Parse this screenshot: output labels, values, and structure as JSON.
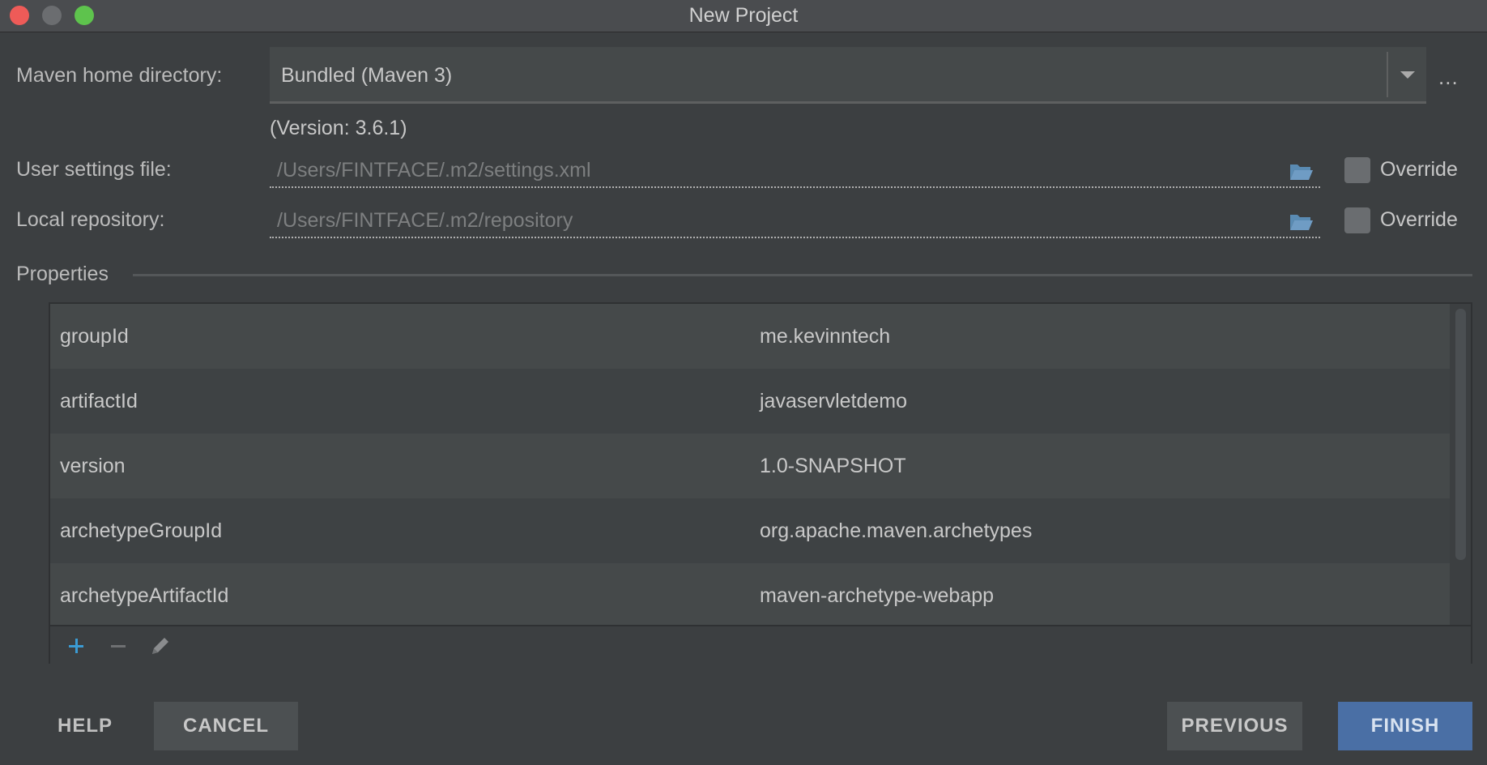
{
  "window": {
    "title": "New Project"
  },
  "maven": {
    "home_label": "Maven home directory:",
    "home_value": "Bundled (Maven 3)",
    "browse_label": "...",
    "version_text": "(Version: 3.6.1)"
  },
  "user_settings": {
    "label": "User settings file:",
    "path": "/Users/FINTFACE/.m2/settings.xml",
    "override_label": "Override"
  },
  "local_repo": {
    "label": "Local repository:",
    "path": "/Users/FINTFACE/.m2/repository",
    "override_label": "Override"
  },
  "properties": {
    "title": "Properties",
    "rows": [
      {
        "key": "groupId",
        "value": "me.kevinntech"
      },
      {
        "key": "artifactId",
        "value": "javaservletdemo"
      },
      {
        "key": "version",
        "value": "1.0-SNAPSHOT"
      },
      {
        "key": "archetypeGroupId",
        "value": "org.apache.maven.archetypes"
      },
      {
        "key": "archetypeArtifactId",
        "value": "maven-archetype-webapp"
      }
    ]
  },
  "buttons": {
    "help": "HELP",
    "cancel": "CANCEL",
    "previous": "PREVIOUS",
    "finish": "FINISH"
  },
  "colors": {
    "background": "#3c3f41",
    "accent": "#4a6fa5",
    "add_icon": "#3b9bd3"
  }
}
